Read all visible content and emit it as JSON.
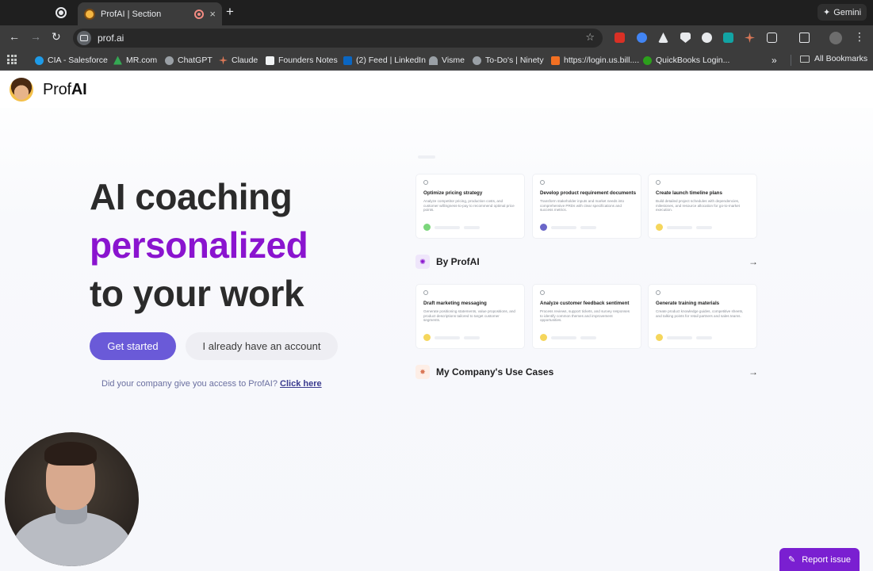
{
  "browser": {
    "active_tab_title": "ProfAI | Section",
    "new_tab_symbol": "+",
    "close_symbol": "×",
    "gemini_label": "Gemini",
    "url": "prof.ai",
    "bookmarks": [
      {
        "label": "CIA - Salesforce",
        "color": "#1e9be8"
      },
      {
        "label": "MR.com",
        "color": "#34a853"
      },
      {
        "label": "ChatGPT",
        "color": "#9aa0a6"
      },
      {
        "label": "Claude",
        "color": "#d97757"
      },
      {
        "label": "Founders Notes",
        "color": "#f1f3f4"
      },
      {
        "label": "(2) Feed | LinkedIn",
        "color": "#0a66c2"
      },
      {
        "label": "Visme",
        "color": "#9aa0a6"
      },
      {
        "label": "To-Do's | Ninety",
        "color": "#9aa0a6"
      },
      {
        "label": "https://login.us.bill....",
        "color": "#f27022"
      },
      {
        "label": "QuickBooks Login...",
        "color": "#2ca01c"
      }
    ],
    "more_bookmarks_symbol": "»",
    "all_bookmarks_label": "All Bookmarks"
  },
  "site": {
    "brand_prefix": "Prof",
    "brand_suffix": "AI"
  },
  "hero": {
    "line1": "AI coaching",
    "line2": "personalized",
    "line3": "to your work",
    "accent_color": "#8a14cf",
    "primary_button": "Get started",
    "secondary_button": "I already have an account",
    "access_question": "Did your company give you access to ProfAI?",
    "access_link": "Click here"
  },
  "cards_row1": [
    {
      "title": "Optimize pricing strategy",
      "desc": "Analyze competitor pricing, production costs, and customer willingness-to-pay to recommend optimal price points.",
      "dot": "#7bd67b"
    },
    {
      "title": "Develop product requirement documents",
      "desc": "Transform stakeholder inputs and market needs into comprehensive PRDs with clear specifications and success metrics.",
      "dot": "#6a66c8"
    },
    {
      "title": "Create launch timeline plans",
      "desc": "Build detailed project schedules with dependencies, milestones, and resource allocation for go-to-market execution.",
      "dot": "#f5d65c"
    }
  ],
  "section_profai": {
    "label": "By ProfAI",
    "badge_color": "#efe6fb",
    "arrow": "→"
  },
  "cards_row2": [
    {
      "title": "Draft marketing messaging",
      "desc": "Generate positioning statements, value propositions, and product descriptions tailored to target customer segments.",
      "dot": "#f5d65c"
    },
    {
      "title": "Analyze customer feedback sentiment",
      "desc": "Process reviews, support tickets, and survey responses to identify common themes and improvement opportunities.",
      "dot": "#f5d65c"
    },
    {
      "title": "Generate training materials",
      "desc": "Create product knowledge guides, competitive sheets, and talking points for retail partners and sales teams.",
      "dot": "#f5d65c"
    }
  ],
  "section_company": {
    "label": "My Company's Use Cases",
    "badge_color": "#fdeee6",
    "arrow": "→"
  },
  "report_issue": "Report issue"
}
